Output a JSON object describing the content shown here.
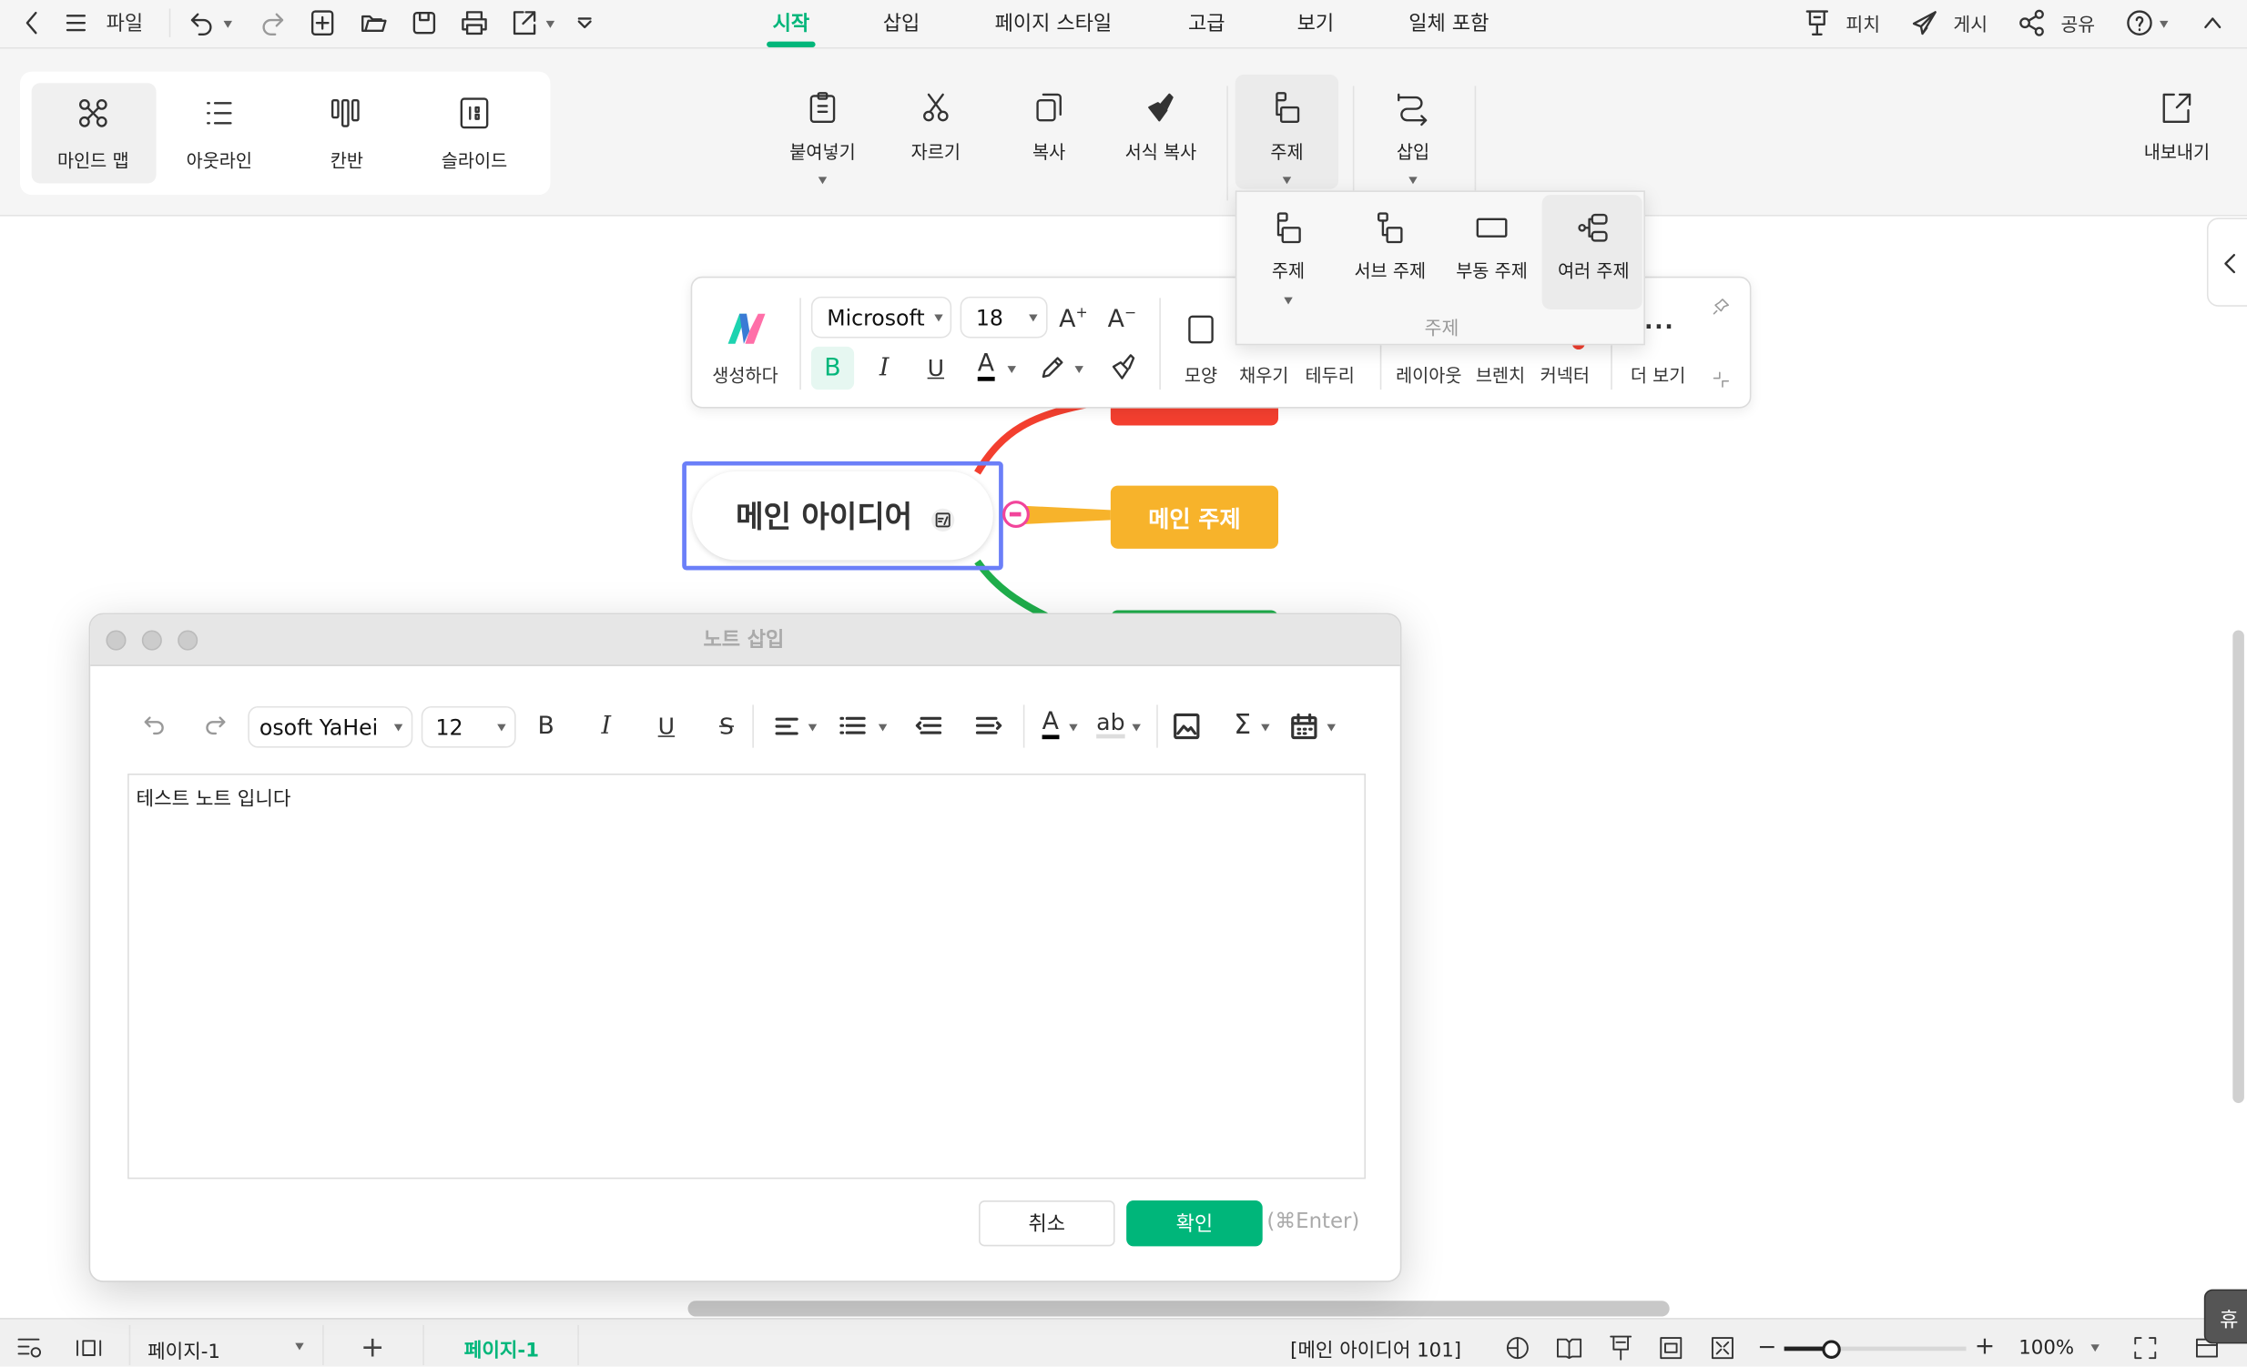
{
  "topbar": {
    "file_label": "파일",
    "tabs": [
      {
        "label": "시작",
        "active": true
      },
      {
        "label": "삽입"
      },
      {
        "label": "페이지 스타일"
      },
      {
        "label": "고급"
      },
      {
        "label": "보기"
      },
      {
        "label": "일체 포함"
      }
    ],
    "right": {
      "pitch": "피치",
      "publish": "게시",
      "share": "공유"
    }
  },
  "views": [
    {
      "label": "마인드 맵",
      "selected": true
    },
    {
      "label": "아웃라인"
    },
    {
      "label": "칸반"
    },
    {
      "label": "슬라이드"
    }
  ],
  "ribbon": {
    "paste": "붙여넣기",
    "cut": "자르기",
    "copy": "복사",
    "format_copy": "서식 복사",
    "topic": "주제",
    "insert": "삽입",
    "export": "내보내기"
  },
  "topic_menu": {
    "items": [
      "주제",
      "서브 주제",
      "부동 주제",
      "여러 주제"
    ],
    "hovered": "여러 주제",
    "group_label": "주제"
  },
  "floatbar": {
    "generate": "생성하다",
    "font": "Microsoft",
    "size": "18",
    "bold": "B",
    "italic": "I",
    "underline": "U",
    "shape": "모양",
    "fill": "채우기",
    "border": "테두리",
    "layout": "레이아웃",
    "branch": "브렌치",
    "connector": "커넥터",
    "more": "더 보기"
  },
  "mindmap": {
    "central": "메인 아이디어",
    "topic": "메인 주제",
    "colors": {
      "selection": "#6b7ff8",
      "topic_yellow": "#f7b32b",
      "topic_red": "#f33f2f",
      "topic_green": "#1fae4b",
      "collapse": "#f2449b"
    }
  },
  "dialog": {
    "title": "노트 삽입",
    "font": "osoft YaHei",
    "size": "12",
    "content": "테스트 노트 입니다",
    "cancel": "취소",
    "confirm": "확인",
    "shortcut": "(⌘Enter)"
  },
  "status": {
    "page_select": "페이지-1",
    "page_tab": "페이지-1",
    "selection_info": "[메인 아이디어 101]",
    "zoom": "100%",
    "zoom_level_percent": 100,
    "side_tab": "휴"
  },
  "accent": "#00b67a"
}
